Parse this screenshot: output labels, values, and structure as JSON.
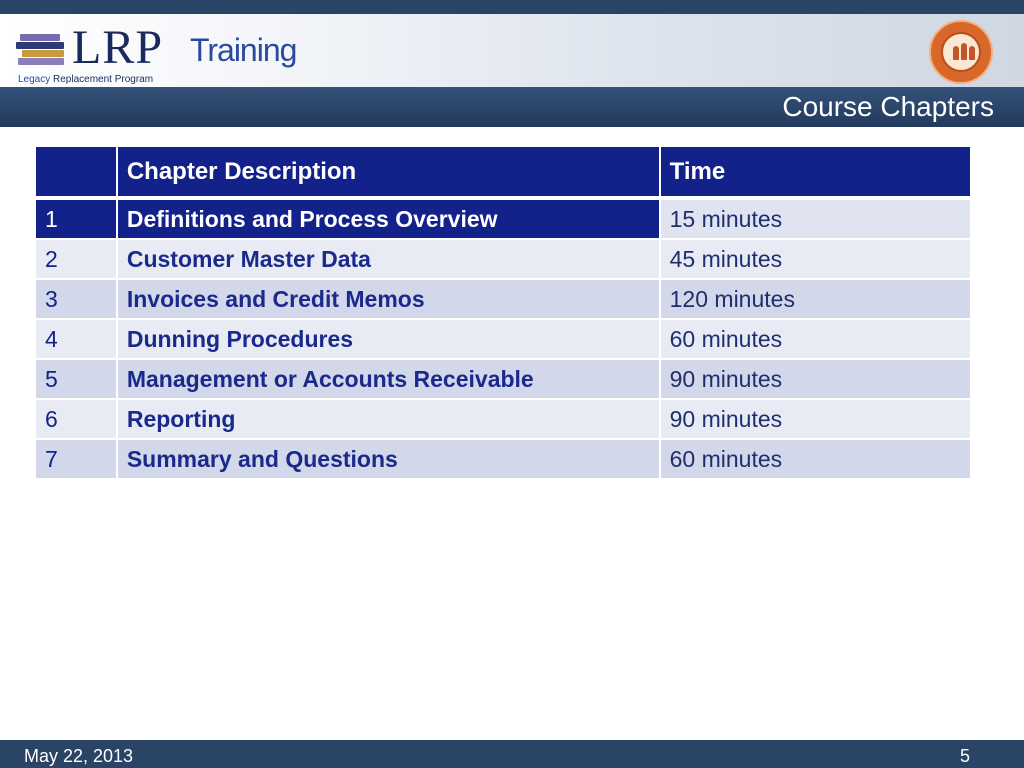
{
  "header": {
    "logo_text": "LRP",
    "product": "Training",
    "tagline_accent": "Legacy",
    "tagline_rest": " Replacement Program"
  },
  "section_title": "Course Chapters",
  "table": {
    "columns": [
      "",
      "Chapter Description",
      "Time"
    ],
    "rows": [
      {
        "num": "1",
        "desc": "Definitions and Process Overview",
        "time": "15 minutes"
      },
      {
        "num": "2",
        "desc": "Customer Master Data",
        "time": "45 minutes"
      },
      {
        "num": "3",
        "desc": "Invoices and Credit Memos",
        "time": "120 minutes"
      },
      {
        "num": "4",
        "desc": "Dunning Procedures",
        "time": "60 minutes"
      },
      {
        "num": "5",
        "desc": "Management or Accounts Receivable",
        "time": "90 minutes"
      },
      {
        "num": "6",
        "desc": "Reporting",
        "time": "90 minutes"
      },
      {
        "num": "7",
        "desc": "Summary and Questions",
        "time": "60 minutes"
      }
    ]
  },
  "footer": {
    "date": "May 22, 2013",
    "page": "5"
  },
  "colors": {
    "header_band": "#2a4466",
    "table_header": "#13218a",
    "row_light": "#e8ebf4",
    "row_dark": "#d2d7e9"
  }
}
